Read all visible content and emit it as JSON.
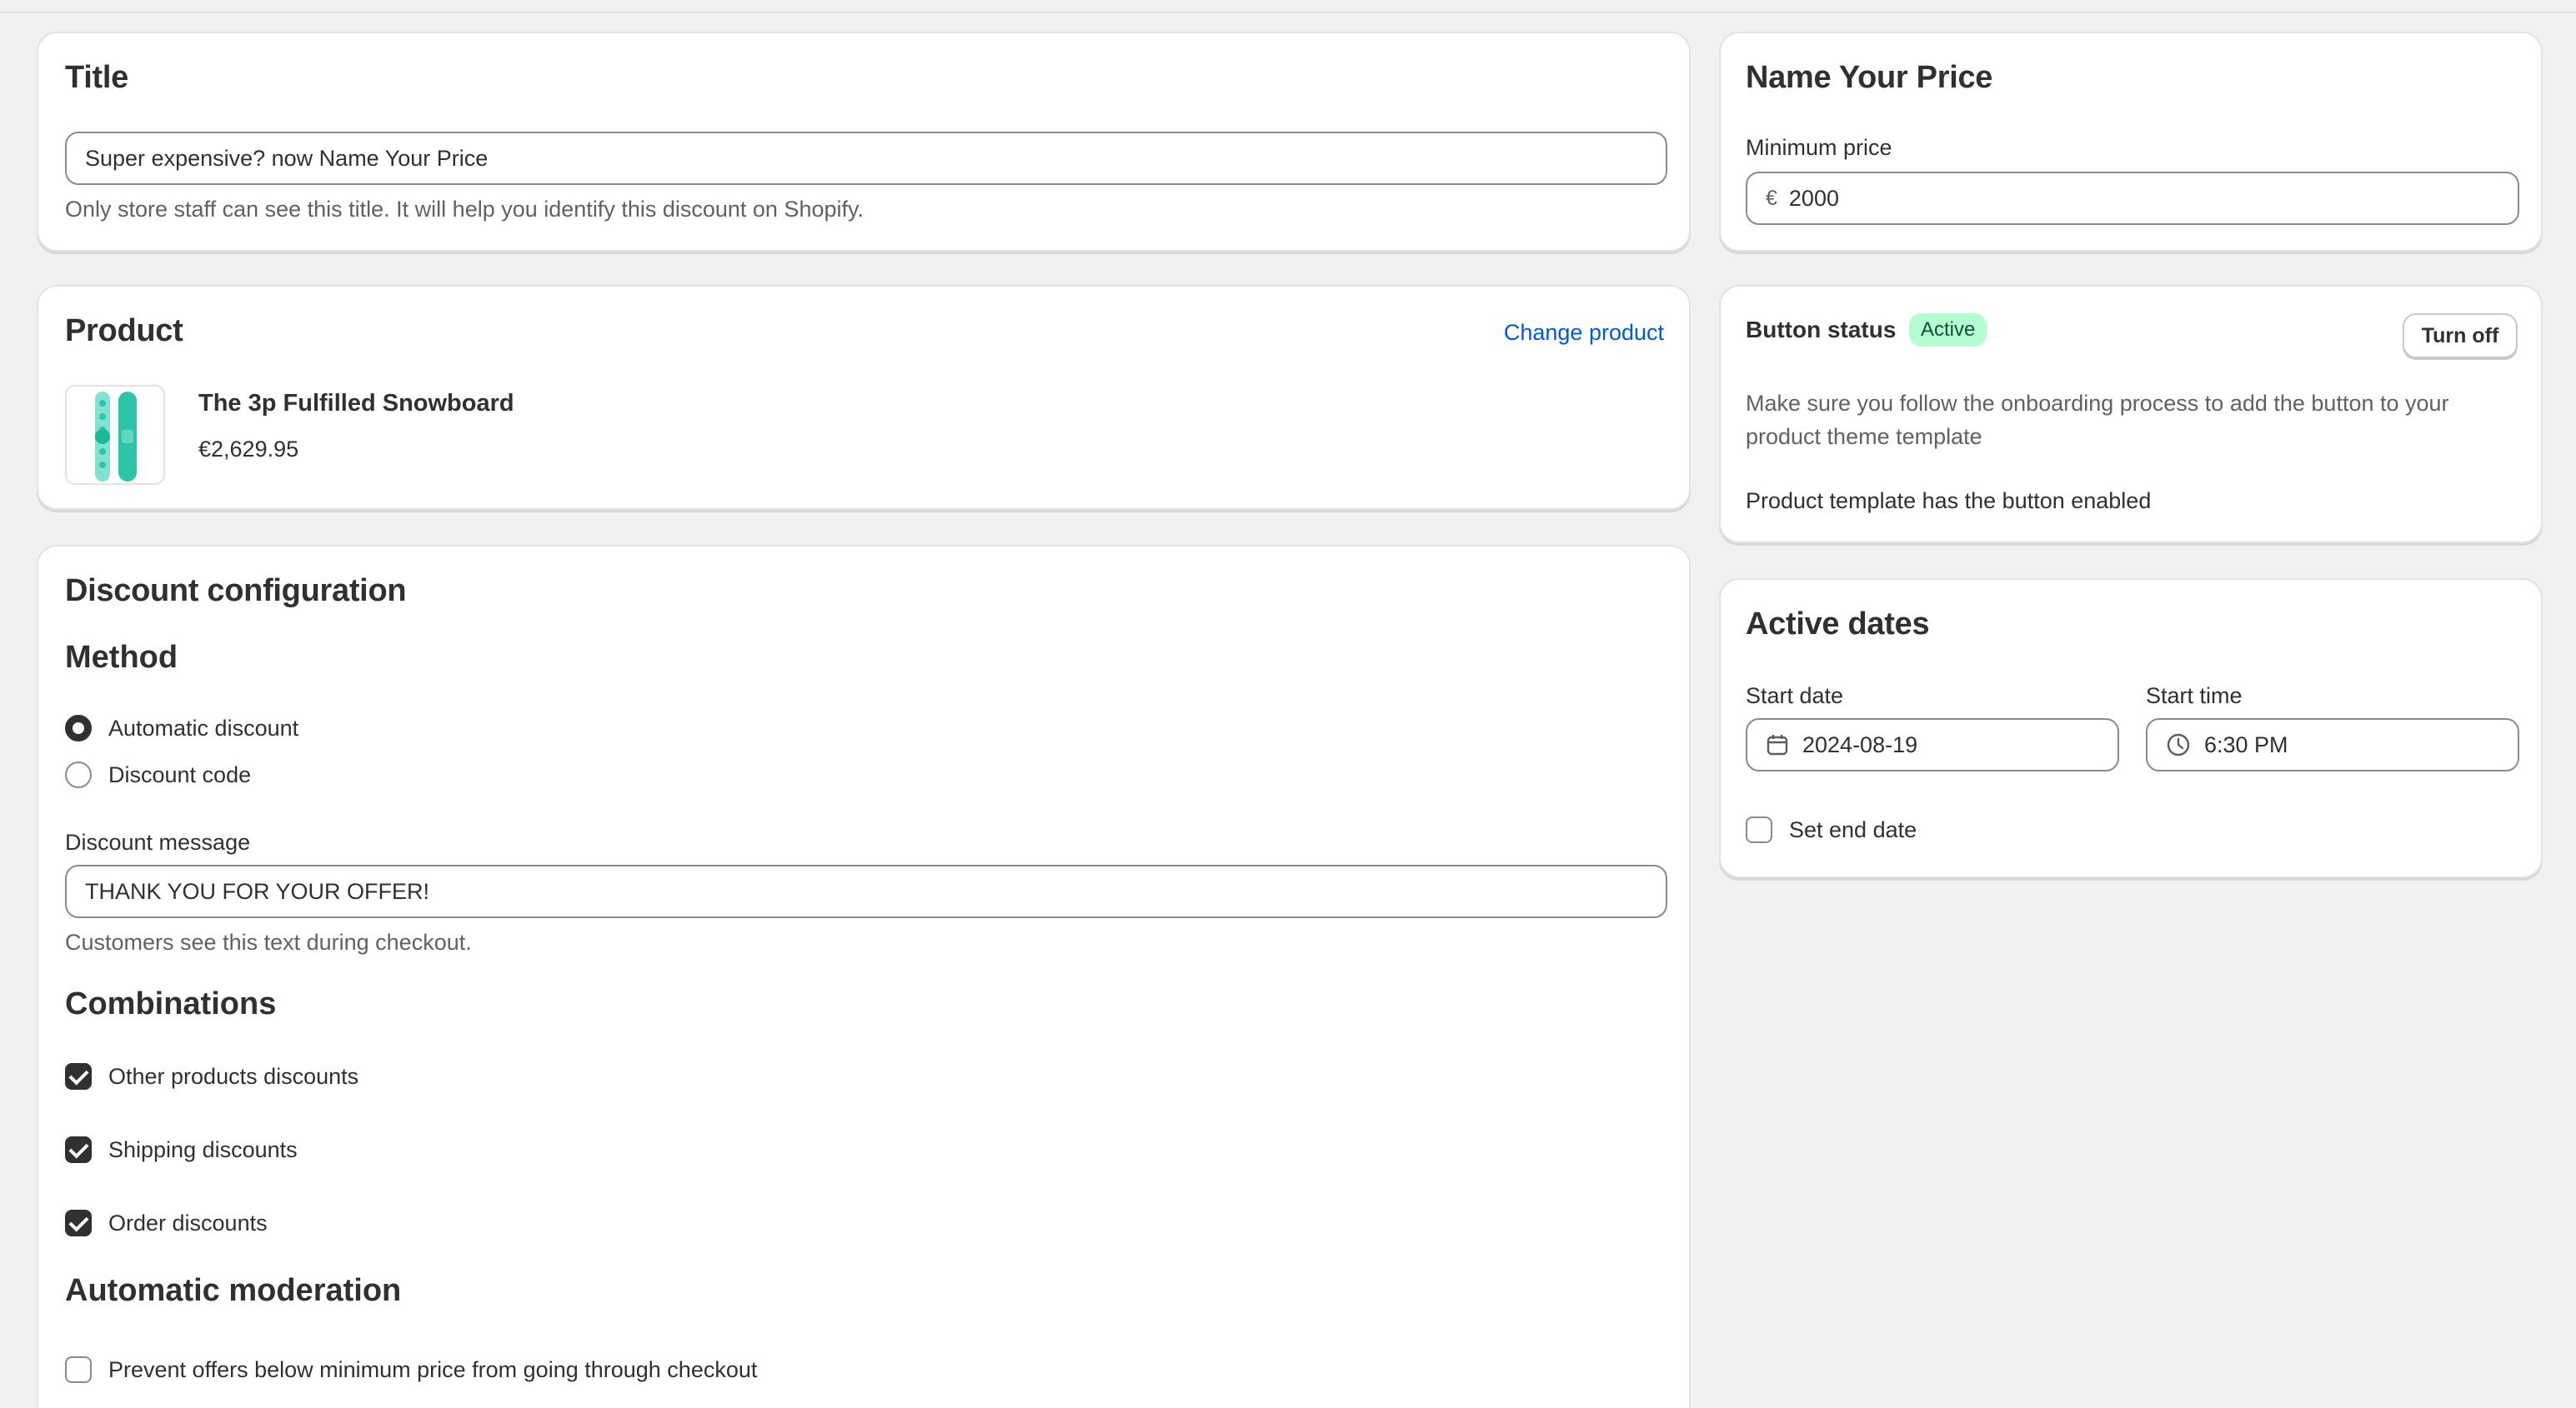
{
  "title_card": {
    "heading": "Title",
    "input_value": "Super expensive? now Name Your Price",
    "help": "Only store staff can see this title. It will help you identify this discount on Shopify."
  },
  "product_card": {
    "heading": "Product",
    "change_link": "Change product",
    "product_name": "The 3p Fulfilled Snowboard",
    "product_price": "€2,629.95",
    "thumb_colors": {
      "board": "#2ec4a6",
      "accent": "#7fe3cf"
    }
  },
  "discount_card": {
    "heading": "Discount configuration",
    "method_heading": "Method",
    "methods": [
      {
        "label": "Automatic discount",
        "selected": true
      },
      {
        "label": "Discount code",
        "selected": false
      }
    ],
    "message_label": "Discount message",
    "message_value": "THANK YOU FOR YOUR OFFER!",
    "message_help": "Customers see this text during checkout.",
    "combinations_heading": "Combinations",
    "combinations": [
      {
        "label": "Other products discounts",
        "checked": true
      },
      {
        "label": "Shipping discounts",
        "checked": true
      },
      {
        "label": "Order discounts",
        "checked": true
      }
    ],
    "moderation_heading": "Automatic moderation",
    "moderation_option": {
      "label": "Prevent offers below minimum price from going through checkout",
      "checked": false
    }
  },
  "nyp_card": {
    "heading": "Name Your Price",
    "min_label": "Minimum price",
    "currency": "€",
    "min_value": "2000"
  },
  "status_card": {
    "label": "Button status",
    "badge": "Active",
    "button": "Turn off",
    "text1": "Make sure you follow the onboarding process to add the button to your product theme template",
    "text2": "Product template has the button enabled"
  },
  "dates_card": {
    "heading": "Active dates",
    "start_date_label": "Start date",
    "start_date": "2024-08-19",
    "start_time_label": "Start time",
    "start_time": "6:30 PM",
    "end_date_label": "Set end date",
    "end_date_checked": false
  }
}
